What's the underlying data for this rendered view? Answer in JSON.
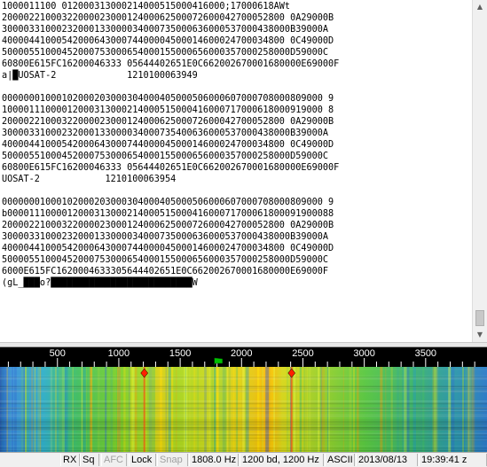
{
  "receive_text": {
    "lines": [
      "1000011100 012000313000214000515000416000;17000618AWt",
      "2000022100032200002300012400062500072600042700052800 0A29000B",
      "30000331000232000133000034000735000636000537000438000B39000A",
      "4000044100054200064300074400004500014600024700034800 0C49000D",
      "50000551000452000753000654000155000656000357000258000D59000C",
      "60800E615FC16200046333 05644402651E0C662002670001680000E69000F",
      "a|█UOSAT-2             1210100063949",
      "",
      "00000001000102000203000304000405000506000607000708000809000 9",
      "10000111000012000313000214000515000416000717000618000919000 8",
      "2000022100032200002300012400062500072600042700052800 0A29000B",
      "30000331000232000133000034000735400636000537000438000B39000A",
      "4000044100054200064300074400004500014600024700034800 0C49000D",
      "50000551000452000753000654000155000656000357000258000D59000C",
      "60800E615FC16200046333 05644402651E0C662002670001680000E69000F",
      "UOSAT-2            1210100063954",
      "",
      "00000001000102000203000304000405000506000607000708000809000 9",
      "b000011100001200031300021400051500041600071700061800091900088",
      "2000022100032200002300012400062500072600042700052800 0A29000B",
      "30000331000232000133000034000735000636000537000438000B39000A",
      "4000044100054200064300074400004500014600024700034800 0C49000D",
      "50000551000452000753000654000155000656000357000258000D59000C",
      "6000E615FC1620004633305644402651E0C662002670001680000E69000F",
      "(gL_███o?██████████████████████████W"
    ]
  },
  "scrollbar": {
    "up_icon": "▲",
    "down_icon": "▼"
  },
  "waterfall": {
    "scale_labels": [
      "500",
      "1000",
      "1500",
      "2000",
      "2500",
      "3000",
      "3500"
    ],
    "scale_values": [
      500,
      1000,
      1500,
      2000,
      2500,
      3000,
      3500
    ],
    "tuned_frequency_hz": 1808,
    "frequency_range": [
      32,
      4000
    ],
    "colors": {
      "background": "#1a3a8a",
      "scale_background": "#000000",
      "scale_text": "#ffffff",
      "marker": "#00c000"
    }
  },
  "status": {
    "rx": "RX",
    "sq": "Sq",
    "afc": "AFC",
    "lock": "Lock",
    "snap": "Snap",
    "freq": "1808.0 Hz",
    "baud": "1200 bd, 1200 Hz",
    "mode": "ASCII",
    "date": "2013/08/13",
    "time": "19:39:41 z"
  }
}
